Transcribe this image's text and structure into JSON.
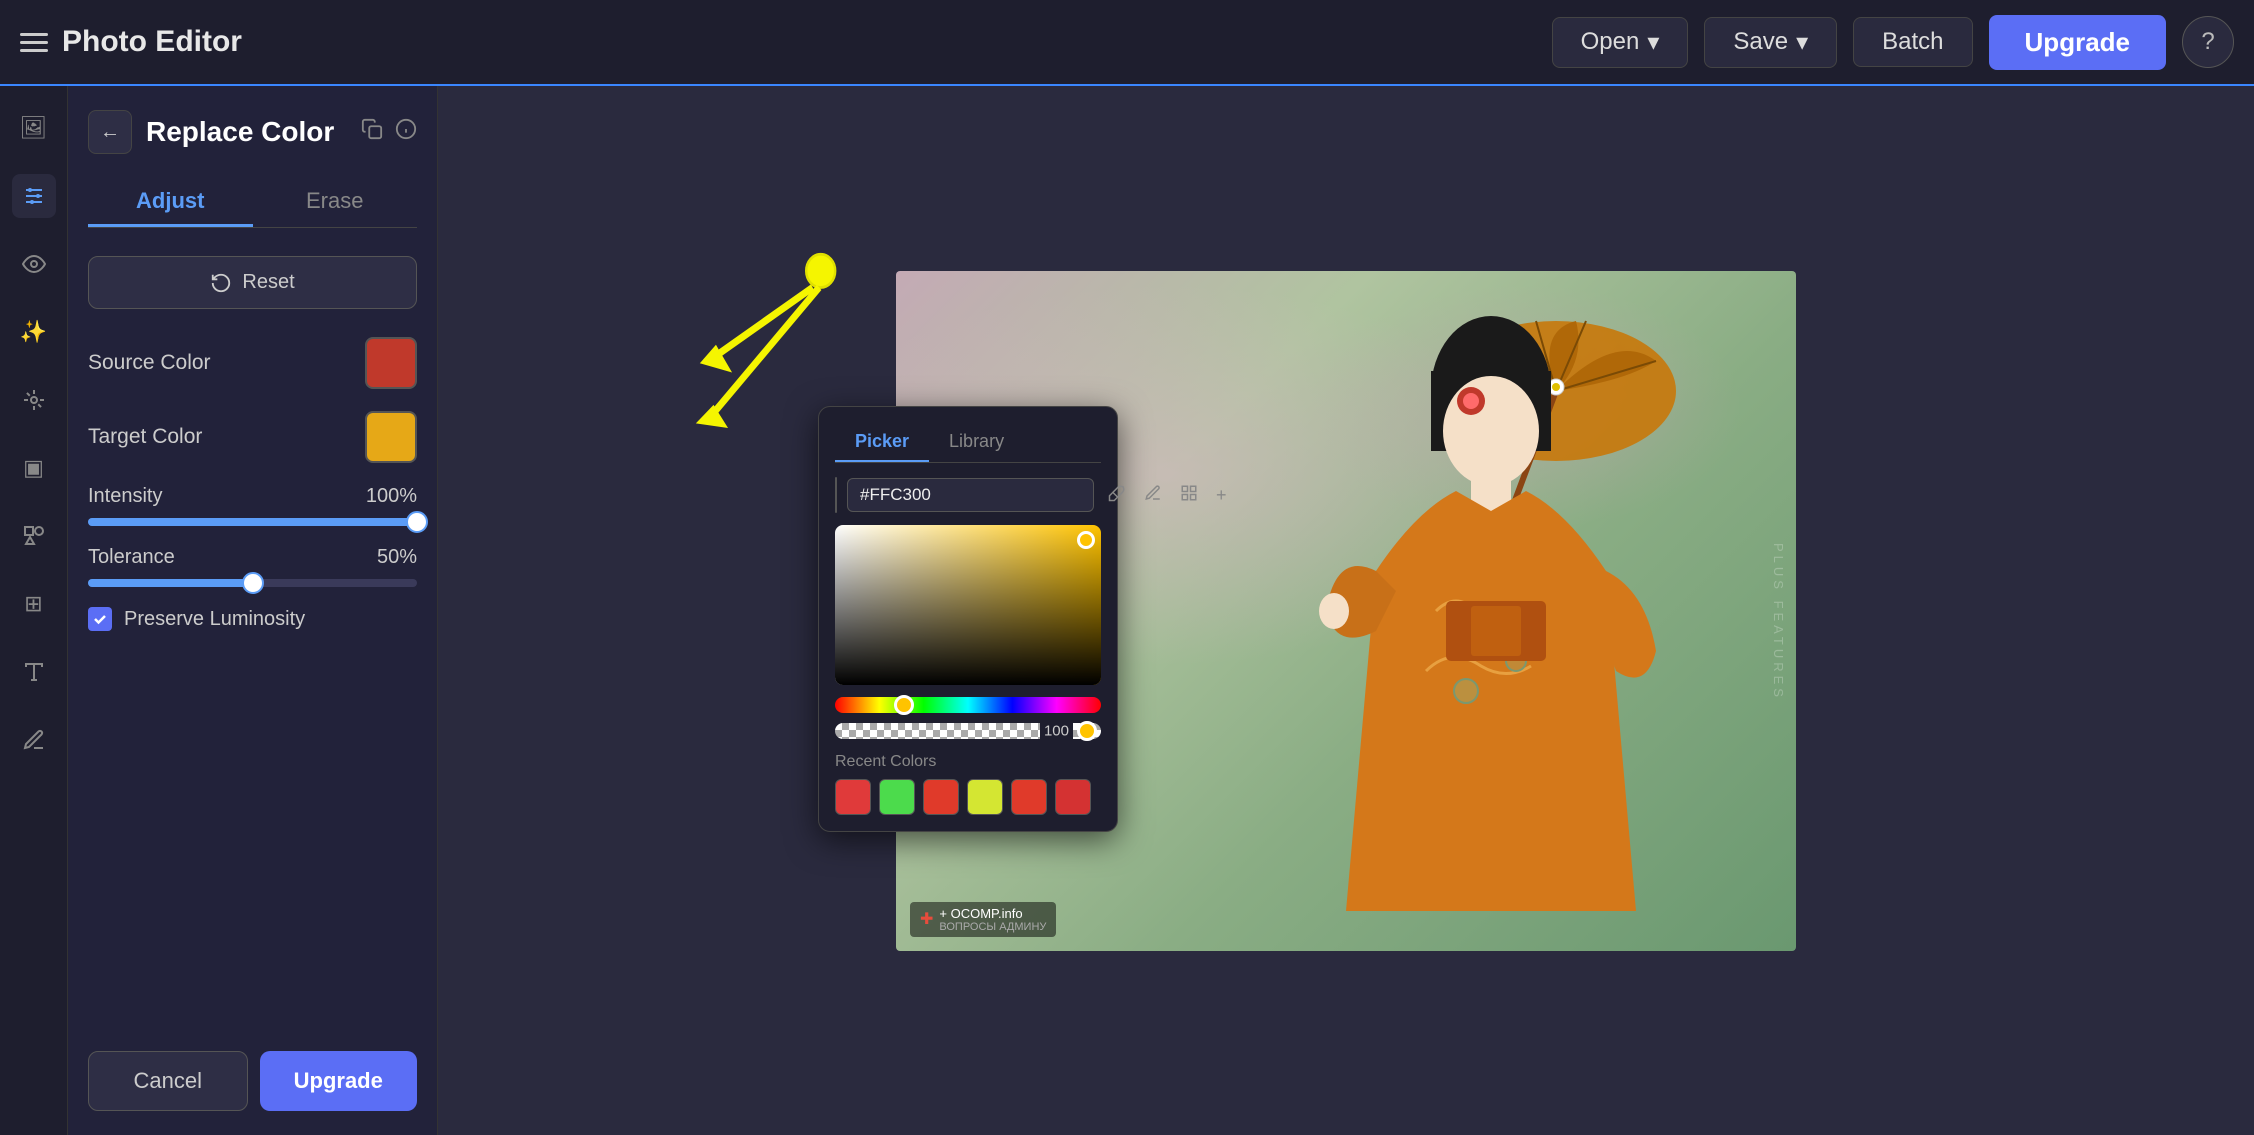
{
  "app": {
    "title": "Photo Editor",
    "border_color": "#3a86ff"
  },
  "topbar": {
    "menu_icon_label": "menu",
    "open_label": "Open",
    "save_label": "Save",
    "batch_label": "Batch",
    "upgrade_label": "Upgrade",
    "help_label": "?"
  },
  "sidebar": {
    "icons": [
      {
        "name": "image-icon",
        "symbol": "🖼"
      },
      {
        "name": "adjustments-icon",
        "symbol": "⚡"
      },
      {
        "name": "eye-icon",
        "symbol": "👁"
      },
      {
        "name": "sparkles-icon",
        "symbol": "✨"
      },
      {
        "name": "brush-icon",
        "symbol": "🖌"
      },
      {
        "name": "layers-icon",
        "symbol": "▣"
      },
      {
        "name": "shapes-icon",
        "symbol": "◉"
      },
      {
        "name": "texture-icon",
        "symbol": "⊞"
      },
      {
        "name": "text-icon",
        "symbol": "T"
      },
      {
        "name": "pen-icon",
        "symbol": "✏"
      }
    ]
  },
  "tool_panel": {
    "back_label": "←",
    "title": "Replace Color",
    "tabs": [
      {
        "label": "Adjust",
        "active": true
      },
      {
        "label": "Erase",
        "active": false
      }
    ],
    "reset_label": "Reset",
    "source_color_label": "Source Color",
    "source_color_hex": "#c0392b",
    "target_color_label": "Target Color",
    "target_color_hex": "#e6a817",
    "intensity_label": "Intensity",
    "intensity_value": "100%",
    "intensity_percent": 100,
    "tolerance_label": "Tolerance",
    "tolerance_value": "50%",
    "tolerance_percent": 50,
    "preserve_luminosity_label": "Preserve Luminosity",
    "cancel_label": "Cancel",
    "upgrade_label": "Upgrade"
  },
  "color_picker": {
    "tabs": [
      {
        "label": "Picker",
        "active": true
      },
      {
        "label": "Library",
        "active": false
      }
    ],
    "hex_value": "#FFC300",
    "alpha_value": "100",
    "recent_colors": [
      {
        "hex": "#e03a3a"
      },
      {
        "hex": "#4cdb4c"
      },
      {
        "hex": "#e03a2a"
      },
      {
        "hex": "#d4e632"
      },
      {
        "hex": "#e03a2a"
      },
      {
        "hex": "#d43232"
      }
    ]
  },
  "photo": {
    "ocomp_label": "+ OCOMP.info",
    "ocomp_sub": "ВОПРОСЫ АДМИНУ",
    "plus_features": "PLUS FEATURES"
  }
}
